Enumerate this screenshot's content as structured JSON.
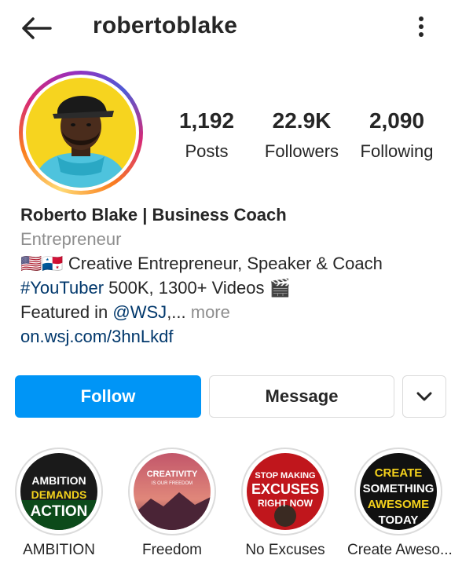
{
  "header": {
    "username": "robertoblake",
    "back_icon": "arrow-left-icon",
    "more_icon": "more-vertical-icon"
  },
  "profile": {
    "avatar_icon": "profile-photo",
    "stats": [
      {
        "value": "1,192",
        "label": "Posts"
      },
      {
        "value": "22.9K",
        "label": "Followers"
      },
      {
        "value": "2,090",
        "label": "Following"
      }
    ]
  },
  "bio": {
    "display_name": "Roberto Blake | Business Coach",
    "category": "Entrepreneur",
    "line1_flags": "🇺🇸🇵🇦",
    "line1_text": " Creative Entrepreneur, Speaker & Coach",
    "line2_hashtag": "#YouTuber",
    "line2_text": " 500K, 1300+ Videos ",
    "line2_emoji": "🎬",
    "line3_prefix": "Featured in ",
    "line3_mention": "@WSJ",
    "line3_ellipsis": ",... ",
    "line3_more": "more",
    "website": "on.wsj.com/3hnLkdf"
  },
  "actions": {
    "follow_label": "Follow",
    "message_label": "Message",
    "dropdown_icon": "chevron-down-icon"
  },
  "highlights": [
    {
      "label": "AMBITION",
      "cover_lines": [
        "AMBITION",
        "DEMANDS",
        "ACTION"
      ]
    },
    {
      "label": "Freedom",
      "cover_lines": [
        "CREATIVITY",
        "IS OUR FREEDOM"
      ]
    },
    {
      "label": "No Excuses",
      "cover_lines": [
        "STOP MAKING",
        "EXCUSES",
        "RIGHT NOW"
      ]
    },
    {
      "label": "Create Aweso...",
      "cover_lines": [
        "CREATE",
        "SOMETHING",
        "AWESOME",
        "TODAY"
      ]
    }
  ],
  "colors": {
    "primary_button": "#0095f6",
    "link": "#00376b",
    "muted_text": "#8e8e8e"
  }
}
